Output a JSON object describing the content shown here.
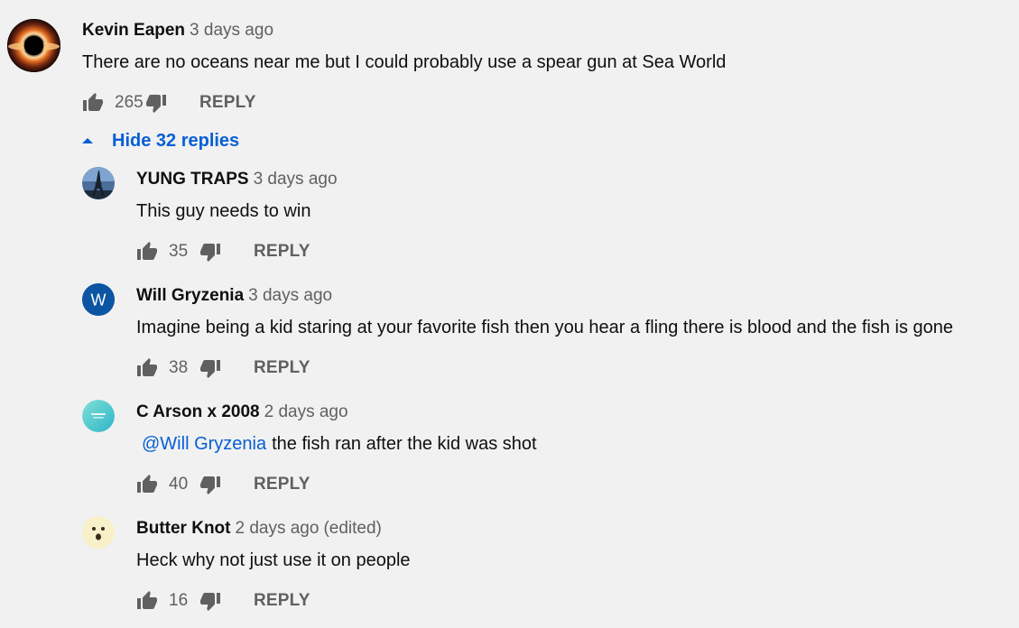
{
  "colors": {
    "background": "#f1f1f1",
    "link_blue": "#065fd4",
    "secondary_text": "#606060",
    "primary_text": "#0f0f0f"
  },
  "comment": {
    "author": "Kevin Eapen",
    "time": "3 days ago",
    "text": "There are no oceans near me but I could probably use a spear gun at Sea World",
    "likes": "265",
    "reply_label": "REPLY",
    "avatar_icon": "black-hole-avatar"
  },
  "hide_replies": {
    "label": "Hide 32 replies",
    "icon": "caret-up-icon"
  },
  "replies": [
    {
      "author": "YUNG TRAPS",
      "time": "3 days ago",
      "edited": "",
      "mention": "",
      "text": "This guy needs to win",
      "likes": "35",
      "reply_label": "REPLY",
      "avatar_icon": "eiffel-tower-avatar"
    },
    {
      "author": "Will Gryzenia",
      "time": "3 days ago",
      "edited": "",
      "mention": "",
      "text": "Imagine being a kid staring at your favorite fish then you hear a fling there is blood and the fish is gone",
      "likes": "38",
      "reply_label": "REPLY",
      "avatar_icon": "letter-w-avatar",
      "avatar_letter": "W"
    },
    {
      "author": "C Arson x 2008",
      "time": "2 days ago",
      "edited": "",
      "mention": "@Will Gryzenia",
      "text": "the fish ran after the kid was shot",
      "likes": "40",
      "reply_label": "REPLY",
      "avatar_icon": "teal-logo-avatar"
    },
    {
      "author": "Butter Knot",
      "time": "2 days ago",
      "edited": "(edited)",
      "mention": "",
      "text": "Heck why not just use it on people",
      "likes": "16",
      "reply_label": "REPLY",
      "avatar_icon": "surprised-face-avatar"
    }
  ]
}
